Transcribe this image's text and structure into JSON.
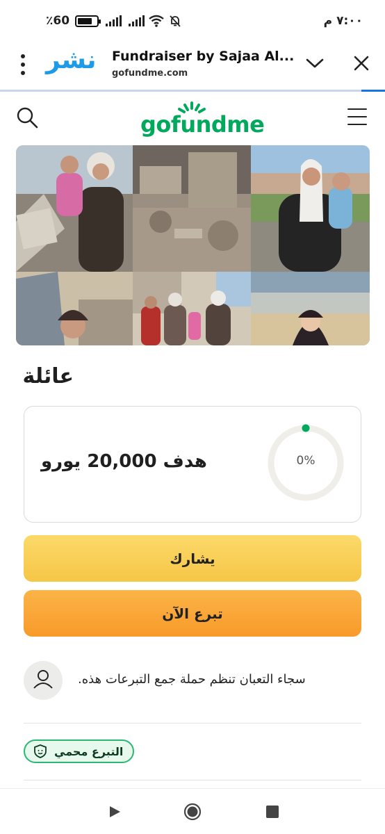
{
  "status_bar": {
    "battery_text": "٪60",
    "time_text": "٧:٠٠ م"
  },
  "browser": {
    "brand_logo_text": "نشر",
    "title": "Fundraiser by Sajaa Al...",
    "url": "gofundme.com"
  },
  "site": {
    "logo_text": "gofundme",
    "logo_color": "#02a95c"
  },
  "campaign": {
    "title": "عائلة",
    "goal_text": "هدف 20,000 يورو",
    "progress_percent": 0,
    "progress_label": "0%"
  },
  "actions": {
    "share_label": "يشارك",
    "donate_label": "تبرع الآن"
  },
  "organizer": {
    "text": "سجاء التعبان تنظم حملة جمع التبرعات هذه."
  },
  "badge": {
    "text": "التبرع محمي"
  },
  "colors": {
    "brand_green": "#02a95c",
    "share_button": "#f6c646",
    "donate_button": "#f89a2a",
    "link_blue": "#1a73e8"
  },
  "icons": {
    "browser_menu": "more-vert-icon",
    "dropdown": "chevron-down-icon",
    "close": "close-icon",
    "search": "search-icon",
    "menu": "hamburger-icon",
    "avatar": "person-icon",
    "badge": "shield-icon",
    "nav_back": "triangle-back-icon",
    "nav_home": "circle-home-icon",
    "nav_recent": "square-recents-icon"
  }
}
